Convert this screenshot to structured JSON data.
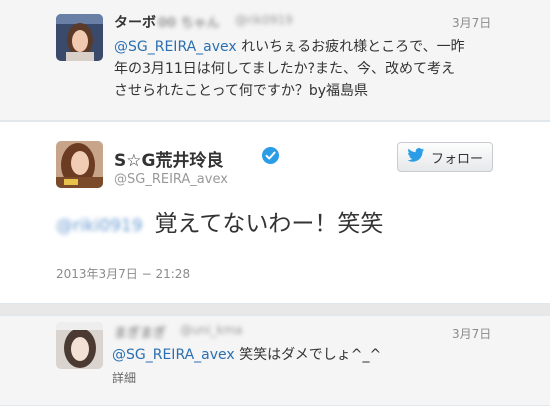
{
  "colors": {
    "mention": "#2a6fb1",
    "verified": "#2b9de6",
    "twitter_bird": "#2b9de6",
    "page_bg": "#e8e8e8"
  },
  "reply_top": {
    "name": "ターボ",
    "name_blurred": "00 ちゃん",
    "handle_blurred": "@rik0919",
    "date": "3月7日",
    "mention": "@SG_REIRA_avex",
    "line1_rest": " れいちぇるお疲れ様ところで、一昨",
    "line2": "年の3月11日は何してましたか?また、今、改めて考え",
    "line3": "させられたことって何ですか？by福島県",
    "avatar_icon": "user-avatar"
  },
  "main_tweet": {
    "name": "S☆G荒井玲良",
    "handle": "@SG_REIRA_avex",
    "follow_label": "フォロー",
    "mention_blurred": "@riki0919",
    "text": "覚えてないわー！笑笑",
    "timestamp": "2013年3月7日 − 21:28",
    "verified_icon": "verified-badge-icon",
    "bird_icon": "twitter-bird-icon"
  },
  "reply_bottom": {
    "name_blurred": "まぎまぎ",
    "handle_blurred": "@uni_kma",
    "date": "3月7日",
    "mention": "@SG_REIRA_avex",
    "text": " 笑笑はダメでしょ^_^",
    "detail_label": "詳細"
  }
}
